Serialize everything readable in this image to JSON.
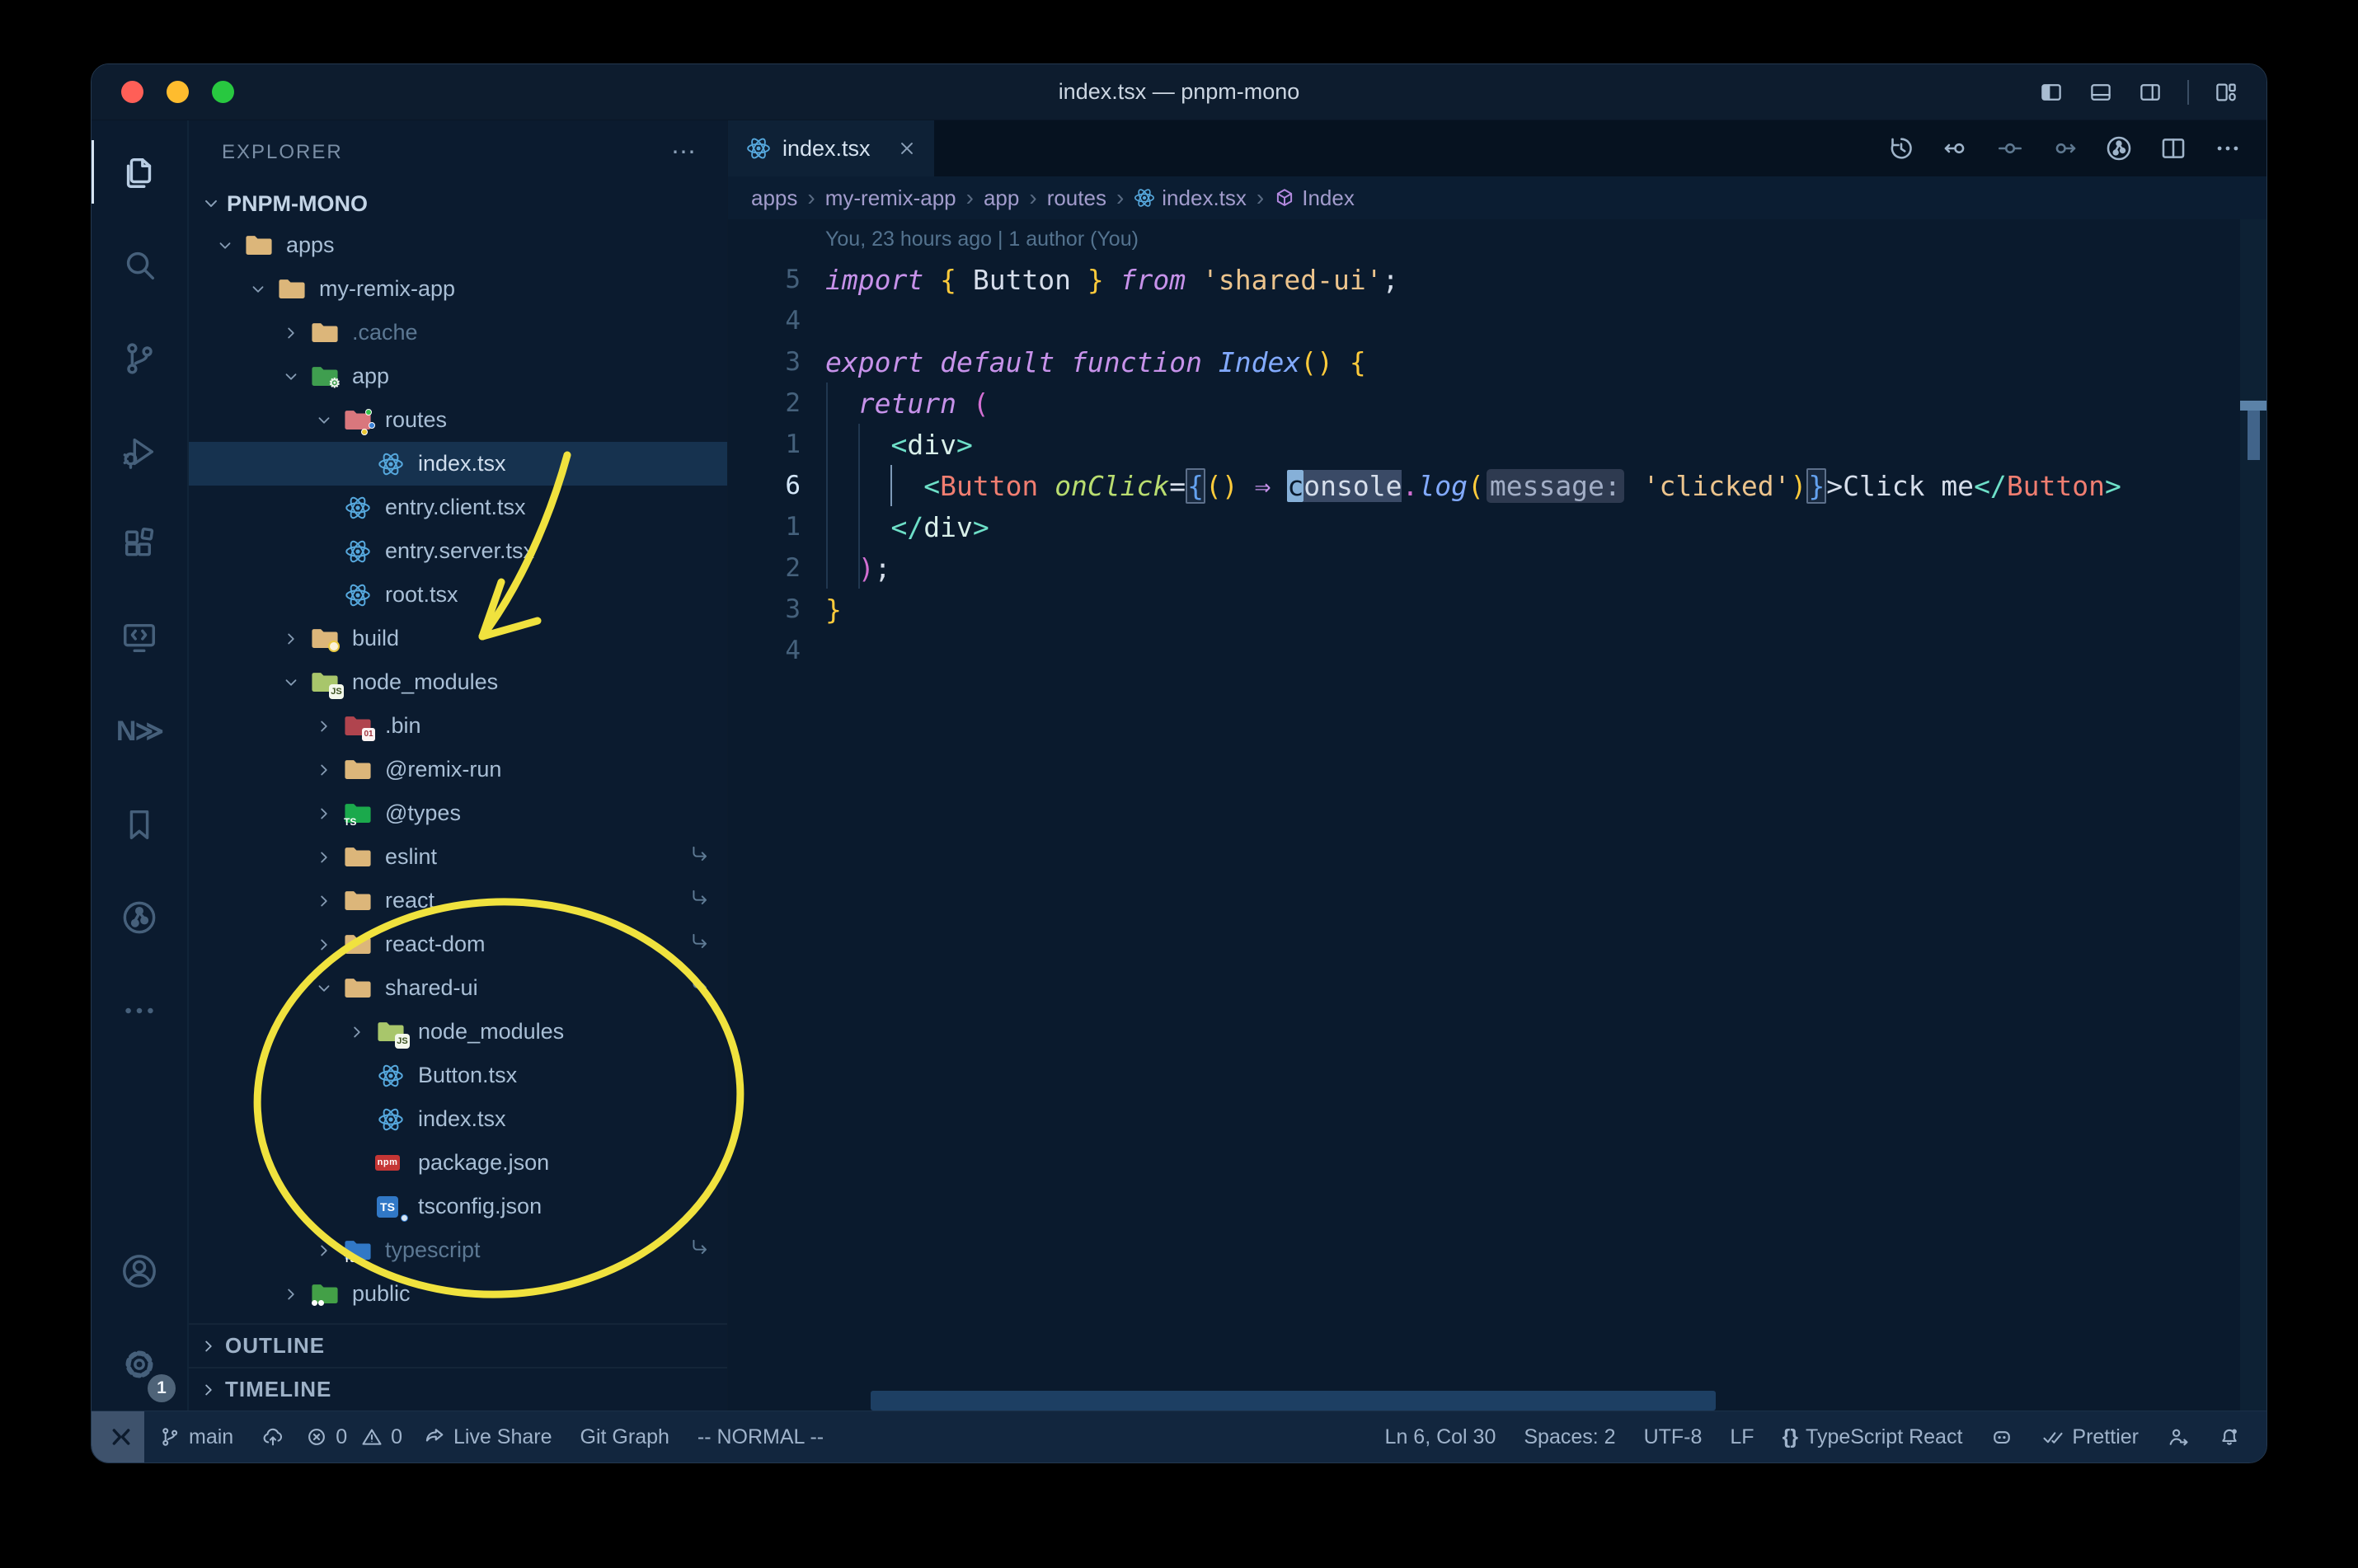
{
  "window": {
    "title": "index.tsx — pnpm-mono",
    "traffic_lights": [
      "#ff5f57",
      "#febc2e",
      "#28c840"
    ],
    "layout_icons": [
      "layout-sidebar-left",
      "layout-panel",
      "layout-sidebar-right",
      "layout-customize"
    ]
  },
  "colors": {
    "background": "#0a1a2d",
    "annotation_yellow": "#f0e23e",
    "selection_row": "#16324f",
    "keyword": "#c792ea",
    "string": "#ecc48d",
    "component_tag": "#f07e71",
    "tag": "#6ee0c8",
    "attribute": "#b9dd70",
    "function": "#82aaff"
  },
  "activity_bar": {
    "top": [
      {
        "name": "explorer",
        "icon": "files",
        "active": true
      },
      {
        "name": "search",
        "icon": "search",
        "active": false
      },
      {
        "name": "source-control",
        "icon": "git-branch-large",
        "active": false
      },
      {
        "name": "run-debug",
        "icon": "debug",
        "active": false
      },
      {
        "name": "extensions",
        "icon": "extensions",
        "active": false
      },
      {
        "name": "remote-explorer",
        "icon": "remote-explorer",
        "active": false
      },
      {
        "name": "nx-console",
        "icon": "nx",
        "active": false,
        "text": "N≫"
      },
      {
        "name": "bookmarks",
        "icon": "bookmark",
        "active": false
      },
      {
        "name": "git-graph",
        "icon": "git-graph-circle",
        "active": false
      },
      {
        "name": "more-views",
        "icon": "ellipsis",
        "active": false
      }
    ],
    "bottom": [
      {
        "name": "accounts",
        "icon": "account"
      },
      {
        "name": "settings",
        "icon": "gear",
        "badge": "1"
      }
    ],
    "settings_badge": "1"
  },
  "sidebar": {
    "header": "EXPLORER",
    "header_actions": "⋯",
    "workspace": {
      "label": "PNPM-MONO"
    },
    "tree": [
      {
        "label": "apps",
        "icon": "folder",
        "level": 1,
        "chevron": "down"
      },
      {
        "label": "my-remix-app",
        "icon": "folder",
        "level": 2,
        "chevron": "down"
      },
      {
        "label": ".cache",
        "icon": "folder",
        "level": 3,
        "chevron": "right",
        "dim": true
      },
      {
        "label": "app",
        "icon": "folder-app",
        "level": 3,
        "chevron": "down"
      },
      {
        "label": "routes",
        "icon": "folder-routes",
        "level": 4,
        "chevron": "down"
      },
      {
        "label": "index.tsx",
        "icon": "react",
        "level": 5,
        "chevron": null,
        "selected": true
      },
      {
        "label": "entry.client.tsx",
        "icon": "react",
        "level": 4,
        "chevron": null
      },
      {
        "label": "entry.server.tsx",
        "icon": "react",
        "level": 4,
        "chevron": null
      },
      {
        "label": "root.tsx",
        "icon": "react",
        "level": 4,
        "chevron": null
      },
      {
        "label": "build",
        "icon": "folder-build",
        "level": 3,
        "chevron": "right"
      },
      {
        "label": "node_modules",
        "icon": "folder-node",
        "level": 3,
        "chevron": "down"
      },
      {
        "label": ".bin",
        "icon": "folder-bin",
        "level": 4,
        "chevron": "right"
      },
      {
        "label": "@remix-run",
        "icon": "folder",
        "level": 4,
        "chevron": "right"
      },
      {
        "label": "@types",
        "icon": "folder-types",
        "level": 4,
        "chevron": "right"
      },
      {
        "label": "eslint",
        "icon": "folder",
        "level": 4,
        "chevron": "right",
        "symlink": true
      },
      {
        "label": "react",
        "icon": "folder",
        "level": 4,
        "chevron": "right",
        "symlink": true
      },
      {
        "label": "react-dom",
        "icon": "folder",
        "level": 4,
        "chevron": "right",
        "symlink": true
      },
      {
        "label": "shared-ui",
        "icon": "folder",
        "level": 4,
        "chevron": "down",
        "symlink": true
      },
      {
        "label": "node_modules",
        "icon": "folder-node",
        "level": 5,
        "chevron": "right"
      },
      {
        "label": "Button.tsx",
        "icon": "react",
        "level": 5,
        "chevron": null
      },
      {
        "label": "index.tsx",
        "icon": "react",
        "level": 5,
        "chevron": null
      },
      {
        "label": "package.json",
        "icon": "npm",
        "level": 5,
        "chevron": null
      },
      {
        "label": "tsconfig.json",
        "icon": "tsfile",
        "level": 5,
        "chevron": null
      },
      {
        "label": "typescript",
        "icon": "folder-ts",
        "level": 4,
        "chevron": "right",
        "dim": true,
        "symlink": true
      },
      {
        "label": "public",
        "icon": "folder-public",
        "level": 3,
        "chevron": "right"
      }
    ],
    "sections": [
      "OUTLINE",
      "TIMELINE"
    ]
  },
  "editor": {
    "tab": {
      "label": "index.tsx",
      "icon": "react"
    },
    "actions": [
      {
        "name": "timeline-history",
        "icon": "history",
        "dim": false
      },
      {
        "name": "previous-change",
        "icon": "commit-left",
        "dim": false
      },
      {
        "name": "commit-details",
        "icon": "commit",
        "dim": true
      },
      {
        "name": "next-change",
        "icon": "commit-right",
        "dim": true
      },
      {
        "name": "git-graph-view",
        "icon": "git-graph-circle",
        "dim": false
      },
      {
        "name": "split-editor",
        "icon": "split",
        "dim": false
      },
      {
        "name": "more-actions",
        "icon": "ellipsis",
        "dim": false
      }
    ],
    "breadcrumbs": [
      {
        "label": "apps"
      },
      {
        "label": "my-remix-app"
      },
      {
        "label": "app"
      },
      {
        "label": "routes"
      },
      {
        "label": "index.tsx",
        "icon": "react"
      },
      {
        "label": "Index",
        "icon": "symbol-cube"
      }
    ],
    "blame": "You, 23 hours ago | 1 author (You)",
    "code_lines": [
      {
        "num": "5",
        "tokens": [
          [
            "kw",
            "import"
          ],
          [
            "plain",
            " "
          ],
          [
            "brace",
            "{"
          ],
          [
            "plain",
            " Button "
          ],
          [
            "brace",
            "}"
          ],
          [
            "plain",
            " "
          ],
          [
            "kw",
            "from"
          ],
          [
            "plain",
            " "
          ],
          [
            "str",
            "'shared-ui'"
          ],
          [
            "plain",
            ";"
          ]
        ]
      },
      {
        "num": "4",
        "tokens": []
      },
      {
        "num": "3",
        "tokens": [
          [
            "kw",
            "export"
          ],
          [
            "plain",
            " "
          ],
          [
            "kw",
            "default"
          ],
          [
            "plain",
            " "
          ],
          [
            "kw",
            "function"
          ],
          [
            "plain",
            " "
          ],
          [
            "fn",
            "Index"
          ],
          [
            "paren",
            "()"
          ],
          [
            "plain",
            " "
          ],
          [
            "brace",
            "{"
          ]
        ]
      },
      {
        "num": "2",
        "tokens": [
          [
            "plain",
            "  "
          ],
          [
            "kw",
            "return"
          ],
          [
            "plain",
            " "
          ],
          [
            "pink",
            "("
          ]
        ]
      },
      {
        "num": "1",
        "tokens": [
          [
            "plain",
            "    "
          ],
          [
            "tag",
            "<"
          ],
          [
            "tagname",
            "div"
          ],
          [
            "tag",
            ">"
          ]
        ]
      },
      {
        "num": "6",
        "active": true,
        "tokens": [
          [
            "plain",
            "      "
          ],
          [
            "tag",
            "<"
          ],
          [
            "comp",
            "Button"
          ],
          [
            "plain",
            " "
          ],
          [
            "attr",
            "onClick"
          ],
          [
            "plain",
            "="
          ],
          [
            "boxed",
            "{"
          ],
          [
            "paren",
            "()"
          ],
          [
            "plain",
            " "
          ],
          [
            "kw",
            "⇒"
          ],
          [
            "plain",
            " "
          ],
          [
            "cursor",
            "c"
          ],
          [
            "hl",
            "onsole"
          ],
          [
            "pink",
            "."
          ],
          [
            "fn",
            "log"
          ],
          [
            "paren",
            "("
          ],
          [
            "inlay",
            "message:"
          ],
          [
            "plain",
            " "
          ],
          [
            "str",
            "'clicked'"
          ],
          [
            "paren",
            ")"
          ],
          [
            "boxed",
            "}"
          ],
          [
            "plain",
            ">"
          ],
          [
            "plain",
            "Click me"
          ],
          [
            "tag",
            "</"
          ],
          [
            "comp",
            "Button"
          ],
          [
            "tag",
            ">"
          ]
        ]
      },
      {
        "num": "1",
        "tokens": [
          [
            "plain",
            "    "
          ],
          [
            "tag",
            "</"
          ],
          [
            "tagname",
            "div"
          ],
          [
            "tag",
            ">"
          ]
        ]
      },
      {
        "num": "2",
        "tokens": [
          [
            "plain",
            "  "
          ],
          [
            "pink",
            ")"
          ],
          [
            "plain",
            ";"
          ]
        ]
      },
      {
        "num": "3",
        "tokens": [
          [
            "brace",
            "}"
          ]
        ]
      },
      {
        "num": "4",
        "tokens": []
      }
    ]
  },
  "status_bar": {
    "left": [
      {
        "name": "branch",
        "icon": "branch",
        "label": "main"
      },
      {
        "name": "sync",
        "icon": "cloud-up",
        "label": ""
      },
      {
        "name": "errors",
        "icon": "error",
        "label": "0"
      },
      {
        "name": "warnings",
        "icon": "warning",
        "label": "0"
      },
      {
        "name": "live-share",
        "icon": "share",
        "label": "Live Share"
      },
      {
        "name": "git-graph",
        "icon": "",
        "label": "Git Graph"
      },
      {
        "name": "vim-mode",
        "icon": "",
        "label": "-- NORMAL --"
      }
    ],
    "right": [
      {
        "name": "cursor-position",
        "icon": "",
        "label": "Ln 6, Col 30"
      },
      {
        "name": "indentation",
        "icon": "",
        "label": "Spaces: 2"
      },
      {
        "name": "encoding",
        "icon": "",
        "label": "UTF-8"
      },
      {
        "name": "eol",
        "icon": "",
        "label": "LF"
      },
      {
        "name": "language-mode",
        "icon": "braces",
        "label": "TypeScript React"
      },
      {
        "name": "copilot",
        "icon": "copilot",
        "label": ""
      },
      {
        "name": "prettier",
        "icon": "dblcheck",
        "label": "Prettier"
      },
      {
        "name": "feedback",
        "icon": "person-arrow",
        "label": ""
      },
      {
        "name": "notifications",
        "icon": "bell",
        "label": ""
      }
    ]
  }
}
